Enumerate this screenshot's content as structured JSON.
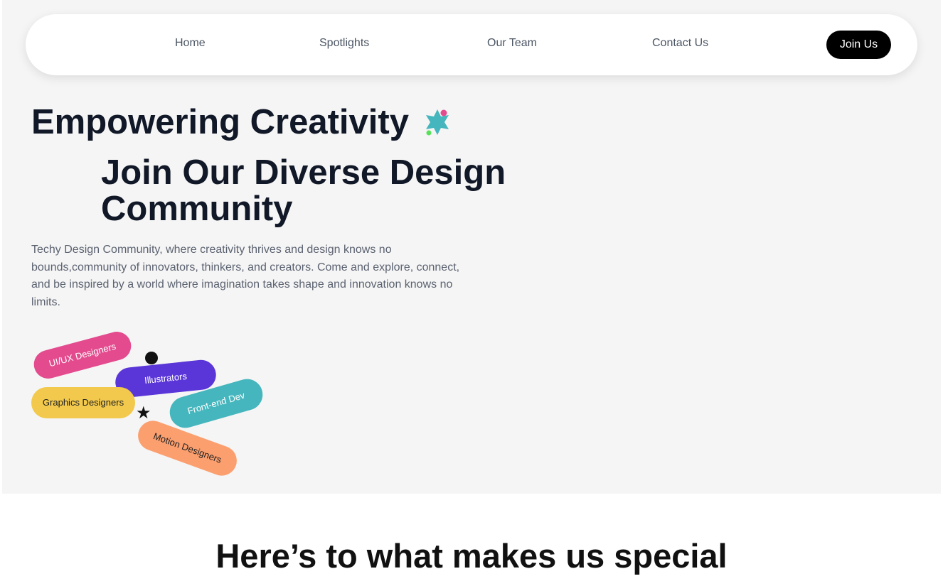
{
  "nav": {
    "links": [
      {
        "label": "Home"
      },
      {
        "label": "Spotlights"
      },
      {
        "label": "Our Team"
      },
      {
        "label": "Contact Us"
      }
    ],
    "cta_label": "Join Us"
  },
  "hero": {
    "title": "Empowering Creativity",
    "title_icon": "sparkle-star-icon",
    "subtitle": "Join Our Diverse Design Community",
    "description": "Techy Design Community, where creativity thrives and design knows no bounds,community of innovators, thinkers, and creators. Come and explore, connect, and be inspired by a world where imagination takes shape and innovation knows no limits.",
    "tags": [
      {
        "label": "UI/UX Designers",
        "color": "#e34b8e"
      },
      {
        "label": "Illustrators",
        "color": "#5a35d8"
      },
      {
        "label": "Graphics Designers",
        "color": "#f2c94c"
      },
      {
        "label": "Front-end Dev",
        "color": "#45b6bd"
      },
      {
        "label": "Motion Designers",
        "color": "#fb9f6f"
      }
    ],
    "decor_icons": [
      "dot-icon",
      "star-icon"
    ]
  },
  "special": {
    "heading": "Here’s to what makes us special"
  },
  "colors": {
    "hero_bg": "#f5f5f5",
    "text_dark": "#111827",
    "cta_bg": "#000000",
    "badge_teal": "#45b6bd",
    "badge_pink": "#e34b8e",
    "badge_green": "#58e05a"
  }
}
